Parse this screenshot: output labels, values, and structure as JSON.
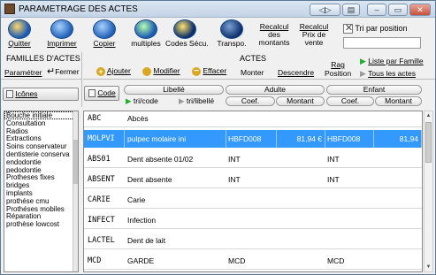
{
  "window": {
    "title": "PARAMETRAGE DES ACTES"
  },
  "titlebar_buttons": [
    "◁▷",
    "▤",
    "▭",
    "✕"
  ],
  "toolbar": {
    "quitter": "Quitter",
    "imprimer": "Imprimer",
    "copier": "Copier",
    "multiples": "multiples",
    "codes_secu": "Codes Sécu.",
    "transpo": "Transpo.",
    "recalcul_montants": [
      "Recalcul",
      "des",
      "montants"
    ],
    "recalcul_prix": [
      "Recalcul",
      "Prix de",
      "vente"
    ],
    "tri_position": "Tri par position"
  },
  "familles": {
    "title": "FAMILLES D'ACTES",
    "parametrer": "Paramétrer",
    "fermer": "Fermer",
    "icones": "Icônes",
    "items": [
      "Bouche initiale",
      "Consultation",
      "Radios",
      "Extractions",
      "Soins conservateur",
      "dentisterie conserva",
      "endodontie",
      "pedodontie",
      "Protheses fixes",
      "bridges",
      "implants",
      "prothése cmu",
      "Prothéses mobiles",
      "Réparation",
      "prothèse lowcost"
    ]
  },
  "actes": {
    "title": "ACTES",
    "ajouter": "Ajouter",
    "modifier": "Modifier",
    "effacer": "Effacer",
    "monter": "Monter",
    "descendre": "Descendre",
    "rag_position": [
      "Rag",
      "Position"
    ],
    "liste_par_famille": "Liste par Famille",
    "tous_les_actes": "Tous les actes",
    "code": "Code",
    "tri_code": "tri/code",
    "tri_libelle": "tri/libellé"
  },
  "columns": {
    "libelle": "Libellé",
    "adulte": "Adulte",
    "enfant": "Enfant",
    "coef": "Coef.",
    "montant": "Montant"
  },
  "rows": [
    {
      "code": "ABC",
      "libelle": "Abcès",
      "adulte_coef": "",
      "adulte_montant": "",
      "enfant_coef": "",
      "enfant_montant": ""
    },
    {
      "code": "MOLPVI",
      "libelle": "pulpec molaire ini",
      "adulte_coef": "HBFD008",
      "adulte_montant": "81,94 €",
      "enfant_coef": "HBFD008",
      "enfant_montant": "81,94"
    },
    {
      "code": "ABS01",
      "libelle": "Dent absente  01/02",
      "adulte_coef": "INT",
      "adulte_montant": "",
      "enfant_coef": "INT",
      "enfant_montant": ""
    },
    {
      "code": "ABSENT",
      "libelle": "Dent absente",
      "adulte_coef": "INT",
      "adulte_montant": "",
      "enfant_coef": "INT",
      "enfant_montant": ""
    },
    {
      "code": "CARIE",
      "libelle": "Carie",
      "adulte_coef": "",
      "adulte_montant": "",
      "enfant_coef": "",
      "enfant_montant": ""
    },
    {
      "code": "INFECT",
      "libelle": "Infection",
      "adulte_coef": "",
      "adulte_montant": "",
      "enfant_coef": "",
      "enfant_montant": ""
    },
    {
      "code": "LACTEL",
      "libelle": "Dent de lait",
      "adulte_coef": "",
      "adulte_montant": "",
      "enfant_coef": "",
      "enfant_montant": ""
    },
    {
      "code": "MCD",
      "libelle": "GARDE",
      "adulte_coef": "MCD",
      "adulte_montant": "",
      "enfant_coef": "MCD",
      "enfant_montant": ""
    }
  ],
  "selected_row": 1,
  "colors": {
    "selection": "#3399ff",
    "accent_green": "#1fae2e"
  }
}
